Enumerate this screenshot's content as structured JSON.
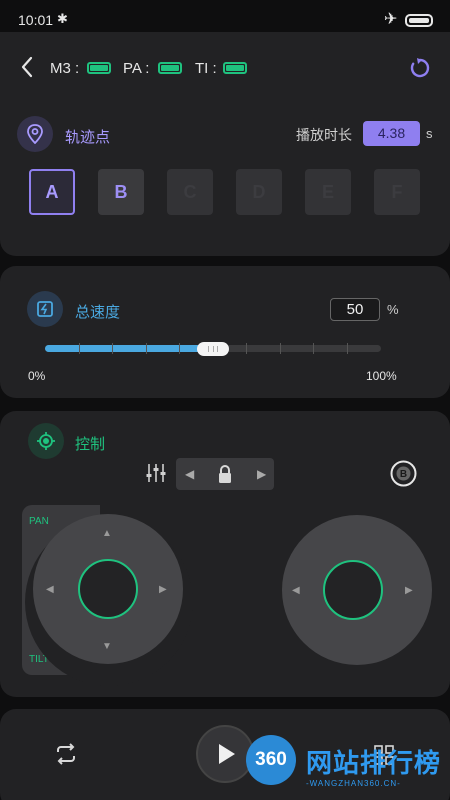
{
  "status_bar": {
    "time": "10:01",
    "bluetooth_icon": "bluetooth-icon",
    "airplane_icon": "airplane-icon",
    "battery_icon": "battery-icon"
  },
  "header": {
    "devices": [
      {
        "label": "M3 :",
        "battery": "green"
      },
      {
        "label": "PA :",
        "battery": "green"
      },
      {
        "label": "TI :",
        "battery": "green"
      }
    ],
    "refresh_icon": "refresh-icon"
  },
  "trajectory": {
    "title": "轨迹点",
    "duration_label": "播放时长",
    "duration_value": "4.38",
    "duration_unit": "s",
    "points": [
      "A",
      "B",
      "C",
      "D",
      "E",
      "F"
    ],
    "selected_point": "A"
  },
  "speed": {
    "title": "总速度",
    "value": "50",
    "unit": "%",
    "min_label": "0%",
    "max_label": "100%",
    "slider_level": 0.5
  },
  "control": {
    "title": "控制",
    "pan_label": "PAN",
    "tilt_label": "TILT"
  },
  "watermark": {
    "badge": "360",
    "text": "网站排行榜",
    "url": "-WANGZHAN360.CN-"
  },
  "colors": {
    "accent_purple": "#9080f0",
    "accent_green": "#1fc27f",
    "accent_blue": "#4aa8e0",
    "background": "#0e0e0f",
    "card": "#222224"
  }
}
